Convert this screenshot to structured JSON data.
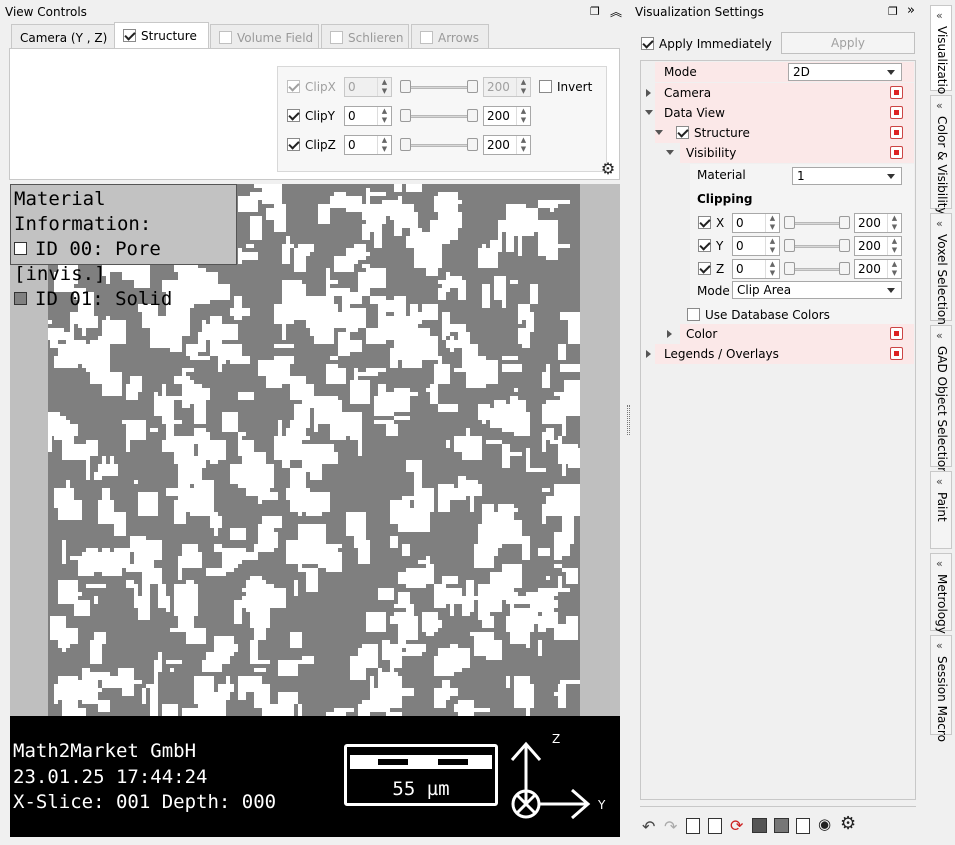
{
  "view_controls": {
    "title": "View Controls",
    "tabs": [
      {
        "label": "Camera (Y , Z)",
        "checkbox": false,
        "disabled": false,
        "active": false
      },
      {
        "label": "Structure",
        "checkbox": true,
        "checked": true,
        "disabled": false,
        "active": true
      },
      {
        "label": "Volume Field",
        "checkbox": true,
        "checked": false,
        "disabled": true,
        "active": false
      },
      {
        "label": "Schlieren",
        "checkbox": true,
        "checked": false,
        "disabled": true,
        "active": false
      },
      {
        "label": "Arrows",
        "checkbox": true,
        "checked": false,
        "disabled": true,
        "active": false
      }
    ],
    "clip": [
      {
        "label": "ClipX",
        "min": "0",
        "max": "200",
        "checked": true,
        "disabled": true
      },
      {
        "label": "ClipY",
        "min": "0",
        "max": "200",
        "checked": true,
        "disabled": false
      },
      {
        "label": "ClipZ",
        "min": "0",
        "max": "200",
        "checked": true,
        "disabled": false
      }
    ],
    "invert_label": "Invert"
  },
  "material_info": {
    "title": "Material Information:",
    "items": [
      {
        "label": "ID 00: Pore [invis.]",
        "color": "#ffffff"
      },
      {
        "label": "ID 01: Solid",
        "color": "#808080"
      }
    ]
  },
  "overlay": {
    "company": "Math2Market GmbH",
    "datetime": "23.01.25 17:44:24",
    "slice": "X-Slice: 001 Depth: 000",
    "scale": "55 µm",
    "axis_up": "Z",
    "axis_right": "Y"
  },
  "vis_settings": {
    "title": "Visualization Settings",
    "apply_immediately": "Apply Immediately",
    "apply_button": "Apply",
    "mode_label": "Mode",
    "mode_value": "2D",
    "camera": "Camera",
    "data_view": "Data View",
    "structure": "Structure",
    "visibility": "Visibility",
    "material_label": "Material",
    "material_value": "1",
    "clipping_label": "Clipping",
    "clip_rows": [
      {
        "axis": "X",
        "min": "0",
        "max": "200"
      },
      {
        "axis": "Y",
        "min": "0",
        "max": "200"
      },
      {
        "axis": "Z",
        "min": "0",
        "max": "200"
      }
    ],
    "clip_mode_label": "Mode",
    "clip_mode_value": "Clip Area",
    "use_db_colors": "Use Database Colors",
    "color": "Color",
    "legends": "Legends / Overlays"
  },
  "side_tabs": [
    "Visualization",
    "Color & Visibility",
    "Voxel Selection",
    "GAD Object Selection",
    "Paint",
    "Metrology",
    "Session Macro"
  ],
  "colors": {
    "pore": "#ffffff",
    "solid": "#7f7f7f",
    "accent_pink": "#fbe8e8"
  }
}
